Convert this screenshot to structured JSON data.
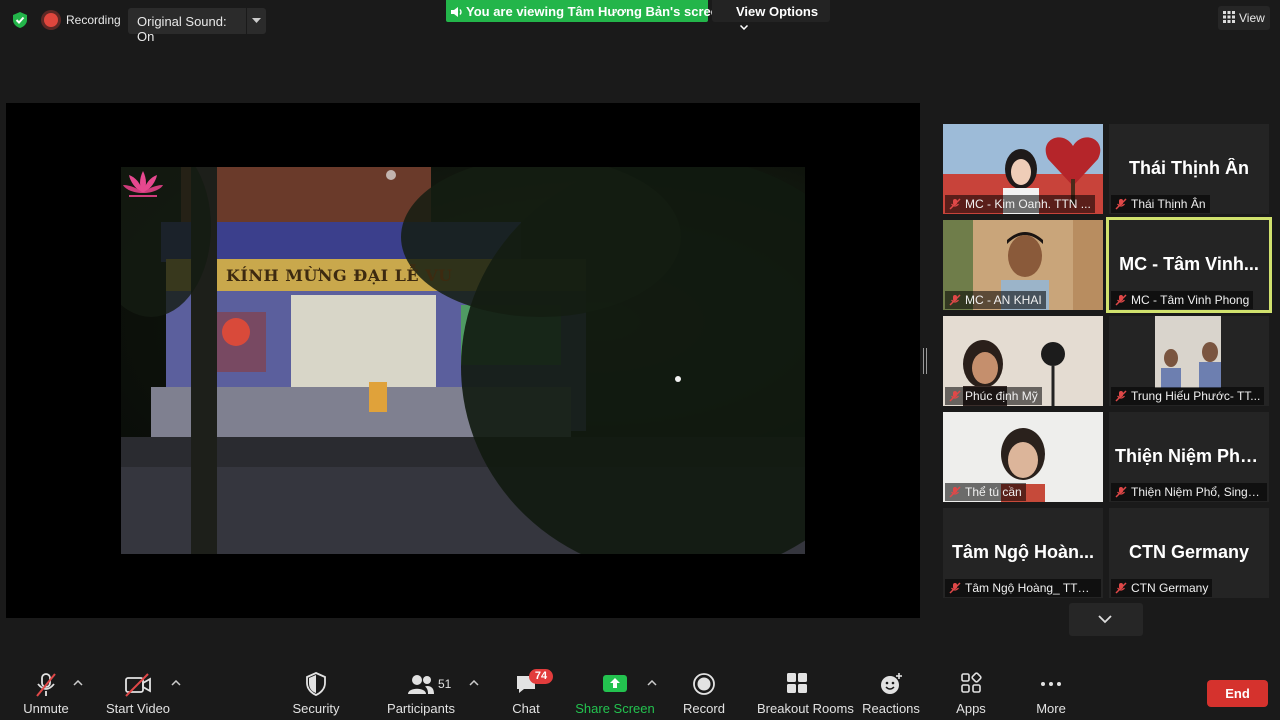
{
  "top_bar": {
    "recording_label": "Recording",
    "original_sound_label": "Original Sound: On",
    "viewing_banner": "You are viewing Tâm Hương Bản's screen",
    "view_options_label": "View Options",
    "view_label": "View"
  },
  "shared_screen": {
    "banner_text": "KÍNH MỪNG ĐẠI LỄ VU"
  },
  "gallery": {
    "tiles": [
      {
        "display_name": "",
        "name_label": "MC - Kim Oanh. TTN ...",
        "video": true,
        "muted": true,
        "active": false
      },
      {
        "display_name": "Thái Thịnh Ân",
        "name_label": "Thái Thịnh Ân",
        "video": false,
        "muted": true,
        "active": false
      },
      {
        "display_name": "",
        "name_label": "MC - AN KHAI",
        "video": true,
        "muted": true,
        "active": false
      },
      {
        "display_name": "MC - Tâm Vinh...",
        "name_label": "MC - Tâm Vinh Phong",
        "video": false,
        "muted": true,
        "active": true
      },
      {
        "display_name": "",
        "name_label": "Phúc định Mỹ",
        "video": true,
        "muted": true,
        "active": false
      },
      {
        "display_name": "",
        "name_label": "Trung Hiếu Phước- TT...",
        "video": true,
        "muted": true,
        "active": false
      },
      {
        "display_name": "",
        "name_label": "Thể tú cần",
        "video": true,
        "muted": true,
        "active": false
      },
      {
        "display_name": "Thiện Niệm Phổ...",
        "name_label": "Thiện Niệm Phổ, Singa...",
        "video": false,
        "muted": true,
        "active": false
      },
      {
        "display_name": "Tâm Ngộ Hoàn...",
        "name_label": "Tâm Ngộ Hoàng_ TTN ...",
        "video": false,
        "muted": true,
        "active": false
      },
      {
        "display_name": "CTN Germany",
        "name_label": "CTN Germany",
        "video": false,
        "muted": true,
        "active": false
      }
    ]
  },
  "toolbar": {
    "unmute_label": "Unmute",
    "start_video_label": "Start Video",
    "security_label": "Security",
    "participants_label": "Participants",
    "participants_count": "51",
    "chat_label": "Chat",
    "chat_badge": "74",
    "share_screen_label": "Share Screen",
    "record_label": "Record",
    "breakout_rooms_label": "Breakout Rooms",
    "reactions_label": "Reactions",
    "apps_label": "Apps",
    "more_label": "More",
    "end_label": "End"
  },
  "colors": {
    "background": "#1a1a1a",
    "share_green": "#23b54a",
    "active_speaker": "#d1e26e",
    "end_red": "#d5322d",
    "badge_red": "#e23c3c",
    "recording_red": "#e0463d"
  },
  "icons": {
    "security_status": "shield-check-icon",
    "recording": "record-dot-icon",
    "mute": "microphone-off-icon",
    "video": "video-off-icon"
  }
}
